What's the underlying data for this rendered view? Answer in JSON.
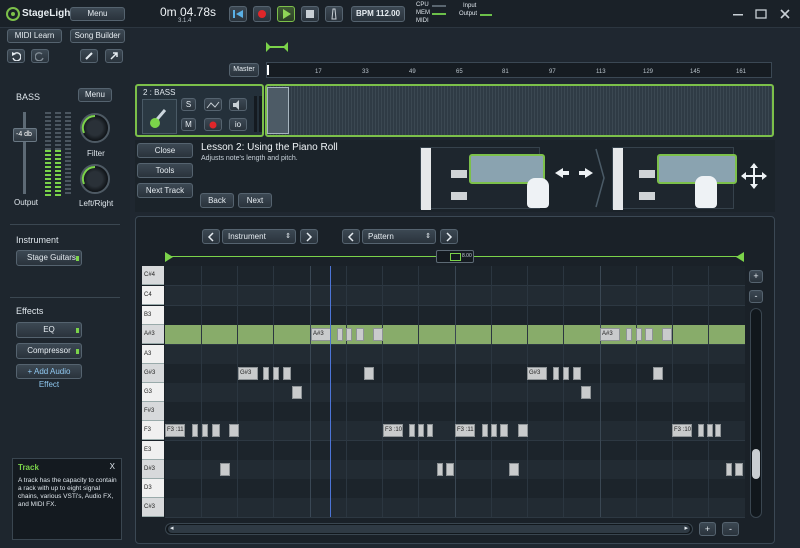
{
  "app": {
    "logo": "StageLight",
    "menu_label": "Menu",
    "midi_learn": "MIDI Learn",
    "song_builder": "Song Builder",
    "time": "0m 04.78s",
    "position": "3.1.4",
    "bpm": "BPM 112.00",
    "meters": {
      "cpu": "CPU",
      "mem": "MEM",
      "midi": "MIDI",
      "input": "Input",
      "output": "Output"
    }
  },
  "timeline": {
    "master": "Master",
    "marks": [
      "1",
      "17",
      "33",
      "49",
      "65",
      "81",
      "97",
      "113",
      "129",
      "145",
      "161"
    ]
  },
  "channel": {
    "name": "BASS",
    "menu_label": "Menu",
    "volume": "-4 db",
    "output_label": "Output",
    "filter_label": "Filter",
    "pan_label": "Left/Right",
    "instrument_heading": "Instrument",
    "instrument": "Stage Guitars",
    "effects_heading": "Effects",
    "effects": [
      "EQ",
      "Compressor"
    ],
    "add_effect": "+ Add Audio Effect"
  },
  "track": {
    "name": "2 : BASS",
    "buttons": [
      "S",
      "M",
      "io"
    ]
  },
  "lesson": {
    "close": "Close",
    "tools": "Tools",
    "next_track": "Next Track",
    "title": "Lesson 2: Using the Piano Roll",
    "subtitle": "Adjusts note's length and pitch.",
    "back": "Back",
    "next": "Next"
  },
  "pianoroll": {
    "instrument_select": "Instrument",
    "pattern_select": "Pattern",
    "loop_value": "8.00",
    "keys": [
      "C#4",
      "C4",
      "B3",
      "A#3",
      "A3",
      "G#3",
      "G3",
      "F#3",
      "F3",
      "E3",
      "D#3",
      "D3",
      "C#3"
    ]
  },
  "help": {
    "title": "Track",
    "close": "X",
    "body": "A track has the capacity to contain a rack with up to eight signal chains, various VSTi's, Audio FX, and MIDI FX."
  }
}
